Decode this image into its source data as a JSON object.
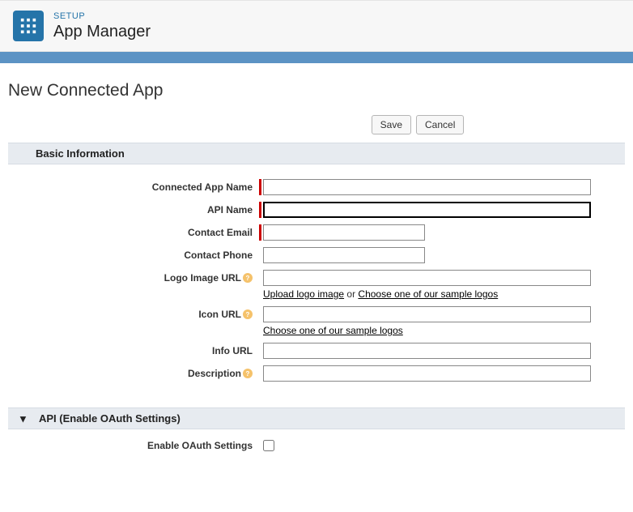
{
  "header": {
    "eyebrow": "SETUP",
    "title": "App Manager"
  },
  "page": {
    "title": "New Connected App"
  },
  "buttons": {
    "save": "Save",
    "cancel": "Cancel"
  },
  "sections": {
    "basic": {
      "title": "Basic Information"
    },
    "api": {
      "title": "API (Enable OAuth Settings)"
    }
  },
  "fields": {
    "connected_app_name": {
      "label": "Connected App Name"
    },
    "api_name": {
      "label": "API Name"
    },
    "contact_email": {
      "label": "Contact Email"
    },
    "contact_phone": {
      "label": "Contact Phone"
    },
    "logo_image_url": {
      "label": "Logo Image URL",
      "helper_link1": "Upload logo image",
      "helper_or": " or ",
      "helper_link2": "Choose one of our sample logos"
    },
    "icon_url": {
      "label": "Icon URL",
      "helper_link1": "Choose one of our sample logos"
    },
    "info_url": {
      "label": "Info URL"
    },
    "description": {
      "label": "Description"
    },
    "enable_oauth": {
      "label": "Enable OAuth Settings"
    }
  }
}
